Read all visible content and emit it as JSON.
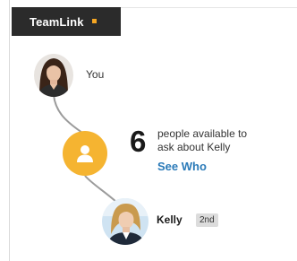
{
  "tab": {
    "label": "TeamLink"
  },
  "path": {
    "you_label": "You",
    "hub_icon": "person-icon",
    "count": "6",
    "description_line1": "people available to",
    "description_line2": "ask about Kelly",
    "see_who_label": "See Who"
  },
  "target": {
    "name": "Kelly",
    "degree": "2nd"
  },
  "colors": {
    "tab_background": "#2b2b2b",
    "accent": "#f5a623",
    "hub": "#f5b431",
    "link": "#2a7ab8",
    "connector": "#9b9b9b"
  }
}
